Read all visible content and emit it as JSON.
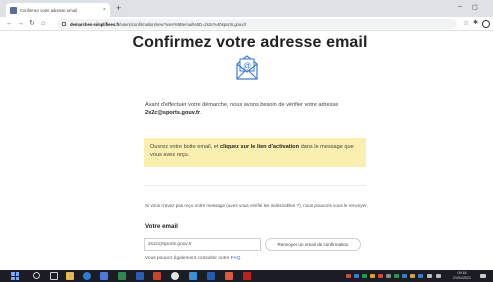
{
  "browser": {
    "tab_title": "Confirmez votre adresse email",
    "tab_close": "×",
    "new_tab": "+",
    "url_host": "demarches-simplifiees.fr",
    "url_path": "/users/confirmation/new?user%5Bemail%5D=2s2c%40sports.gouv.fr",
    "win_minimize": "–",
    "win_restore": "◻",
    "star": "☆"
  },
  "page": {
    "title": "Confirmez votre adresse email",
    "intro_text": "Avant d'effectuer votre démarche, nous avons besoin de vérifier votre adresse",
    "intro_email": "2s2c@sports.gouv.fr",
    "intro_end": ".",
    "notice_part1": "Ouvrez votre boite email, et",
    "notice_strong": "cliquez sur le lien d'activation",
    "notice_part2": "dans le message que vous avez reçu.",
    "resend_info": "Si vous n'avez pas reçu notre message (avez-vous vérifié les indésirables ?), nous pouvons vous le renvoyer.",
    "email_label": "Votre email",
    "email_value": "2s2c@sports.gouv.fr",
    "resend_button": "Renvoyer un email de confirmation",
    "faq_text": "Vous pouvez également consulter notre",
    "faq_link": "FAQ",
    "faq_end": "."
  },
  "taskbar": {
    "clock_time": "09:18",
    "clock_date": "21/01/2021"
  },
  "colors": {
    "notice_bg": "#fbefb0",
    "link": "#2f5fd0",
    "icon_blue": "#3a7bd5"
  }
}
